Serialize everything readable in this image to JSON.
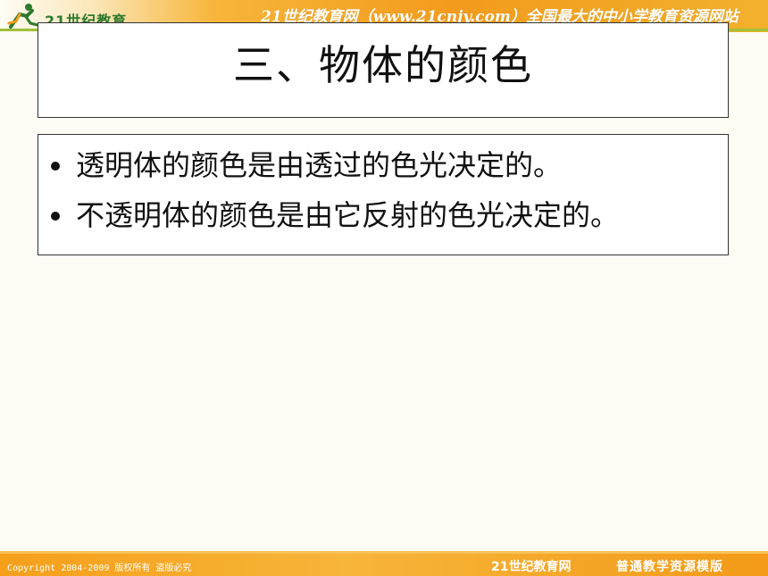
{
  "header": {
    "logo_text": "21世纪教育",
    "tagline": "21世纪教育网（www.21cnjy.com）全国最大的中小学教育资源网站"
  },
  "slide": {
    "title": "三、物体的颜色",
    "bullets": [
      "透明体的颜色是由透过的色光决定的。",
      "不透明体的颜色是由它反射的色光决定的。"
    ]
  },
  "footer": {
    "copyright": "Copyright 2004-2009 版权所有 盗版必究",
    "site_name": "21世纪教育网",
    "template_name": "普通教学资源模版"
  },
  "colors": {
    "band_orange": "#f29b1c",
    "accent_green": "#9fc13a",
    "background": "#fffcf5"
  }
}
